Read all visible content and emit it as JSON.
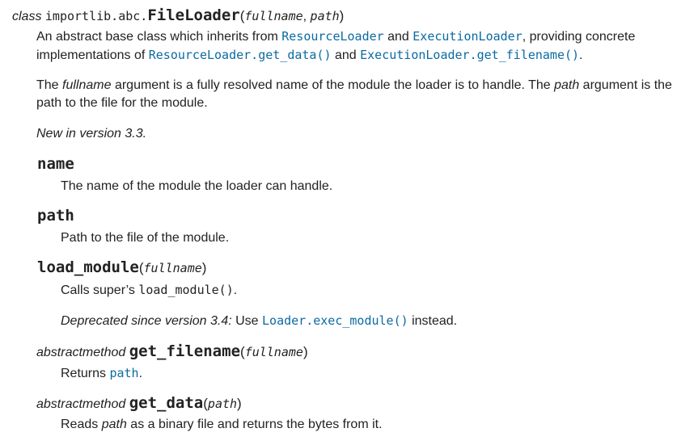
{
  "class_sig": {
    "prefix": "class",
    "module": "importlib.abc.",
    "name": "FileLoader",
    "open_paren": "(",
    "arg1": "fullname",
    "sep": ", ",
    "arg2": "path",
    "close_paren": ")"
  },
  "desc1": {
    "t1": "An abstract base class which inherits from ",
    "link1": "ResourceLoader",
    "t2": " and ",
    "link2": "ExecutionLoader",
    "t3": ", providing concrete implementations of ",
    "link3": "ResourceLoader.get_data()",
    "t4": " and ",
    "link4": "ExecutionLoader.get_filename()",
    "t5": "."
  },
  "desc2": {
    "t1": "The ",
    "em1": "fullname",
    "t2": " argument is a fully resolved name of the module the loader is to handle. The ",
    "em2": "path",
    "t3": " argument is the path to the file for the module."
  },
  "versionadded": "New in version 3.3.",
  "attr_name": {
    "name": "name",
    "desc": "The name of the module the loader can handle."
  },
  "attr_path": {
    "name": "path",
    "desc": "Path to the file of the module."
  },
  "load_module": {
    "name": "load_module",
    "open_paren": "(",
    "arg": "fullname",
    "close_paren": ")",
    "desc_t1": "Calls super’s ",
    "desc_code": "load_module()",
    "desc_t2": ".",
    "deprecated_label": "Deprecated since version 3.4:",
    "deprecated_t1": " Use ",
    "deprecated_link": "Loader.exec_module()",
    "deprecated_t2": " instead."
  },
  "get_filename": {
    "prefix": "abstractmethod",
    "name": "get_filename",
    "open_paren": "(",
    "arg": "fullname",
    "close_paren": ")",
    "desc_t1": "Returns ",
    "desc_link": "path",
    "desc_t2": "."
  },
  "get_data": {
    "prefix": "abstractmethod",
    "name": "get_data",
    "open_paren": "(",
    "arg": "path",
    "close_paren": ")",
    "desc_t1": "Reads ",
    "desc_em": "path",
    "desc_t2": " as a binary file and returns the bytes from it."
  }
}
